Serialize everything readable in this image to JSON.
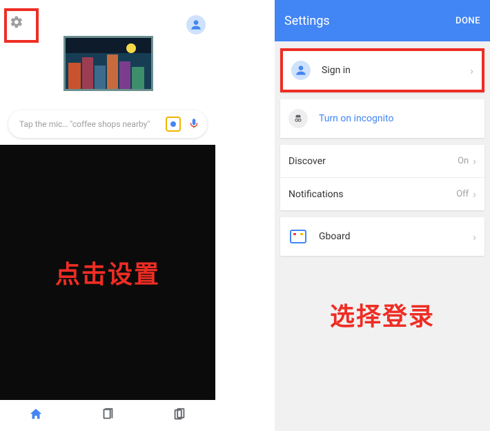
{
  "left": {
    "search_placeholder": "Tap the mic… \"coffee shops nearby\"",
    "caption": "点击设置"
  },
  "right": {
    "header_title": "Settings",
    "header_done": "DONE",
    "signin_label": "Sign in",
    "incognito_label": "Turn on incognito",
    "discover_label": "Discover",
    "discover_value": "On",
    "notifications_label": "Notifications",
    "notifications_value": "Off",
    "gboard_label": "Gboard",
    "caption": "选择登录"
  }
}
